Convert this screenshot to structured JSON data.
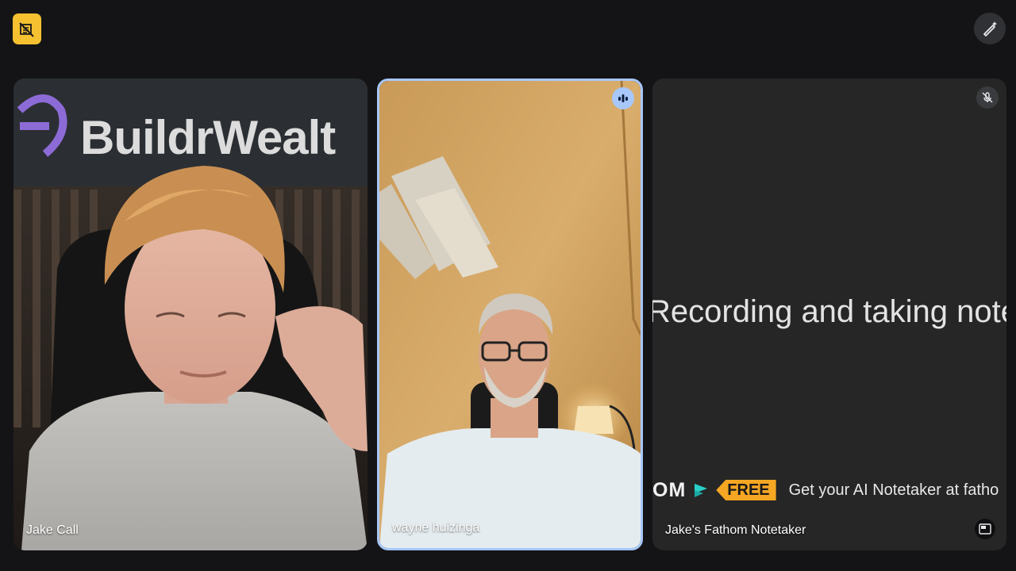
{
  "top_bar": {
    "left_icon": "camera-off-icon",
    "right_icon": "magic-pen-icon"
  },
  "tiles": [
    {
      "name": "Jake Call",
      "background_text": "BuildrWealt"
    },
    {
      "name": "wayne huizinga",
      "status_icon": "speaking-indicator-icon"
    },
    {
      "name": "Jake's Fathom Notetaker",
      "status_icon": "mic-off-icon",
      "main_text": "Recording and taking notes",
      "promo_brand": "OM",
      "promo_badge": "FREE",
      "promo_text": "Get your AI Notetaker at fatho",
      "corner_icon": "picture-in-picture-icon"
    }
  ],
  "colors": {
    "background": "#141416",
    "active_border": "#a8c7fa",
    "badge_yellow": "#f6c130",
    "promo_orange": "#f5a623"
  }
}
